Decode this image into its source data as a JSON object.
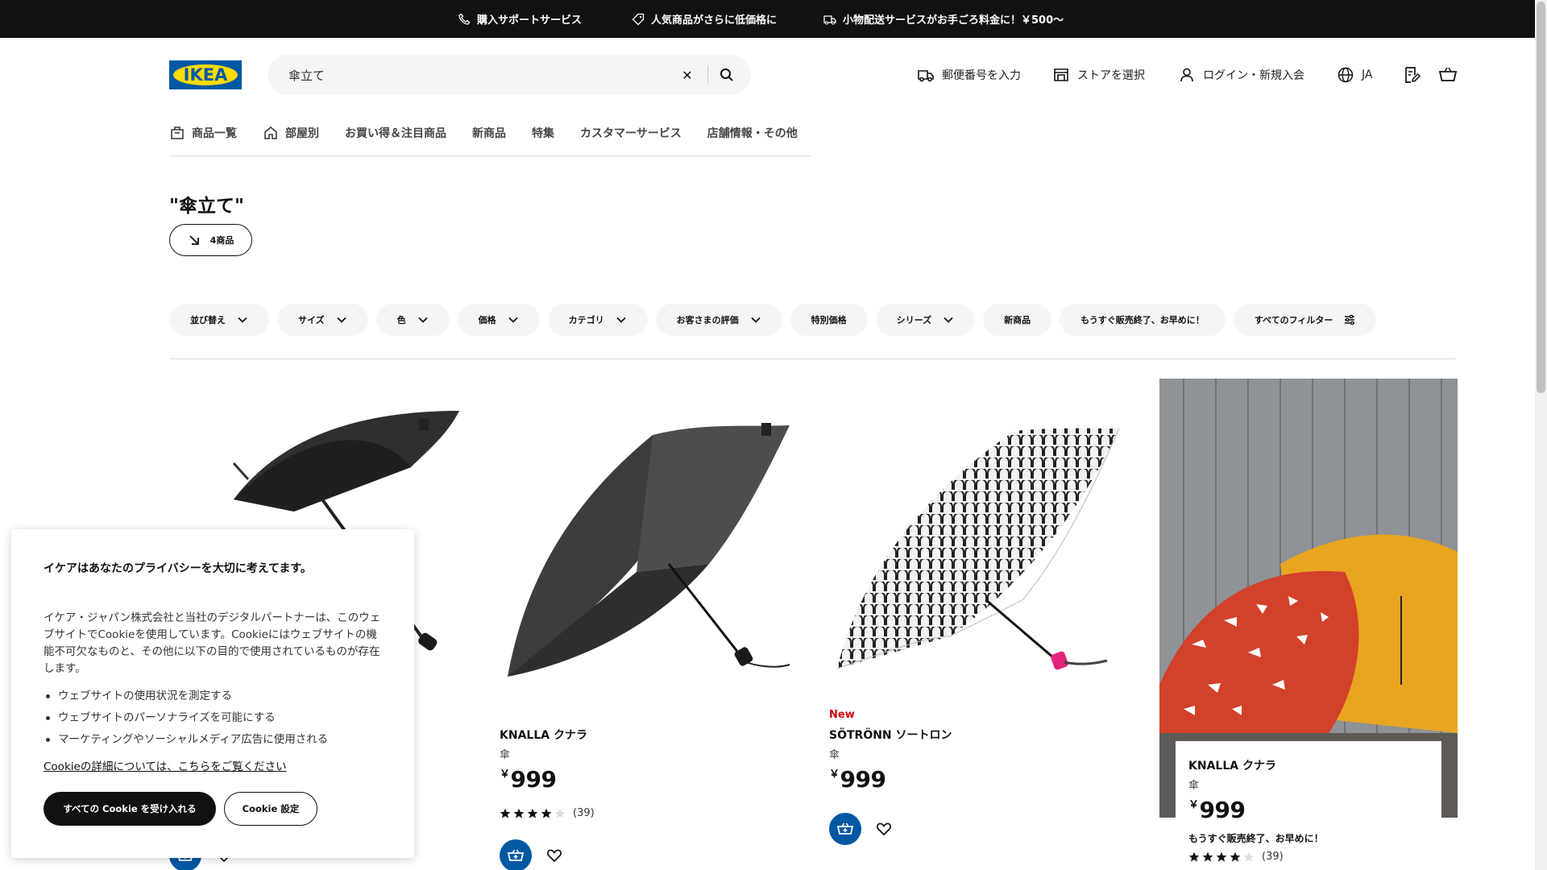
{
  "promo_bar": {
    "items": [
      {
        "label": "購入サポートサービス",
        "icon": "phone-icon"
      },
      {
        "label": "人気商品がさらに低価格に",
        "icon": "price-tag-icon"
      },
      {
        "label": "小物配送サービスがお手ごろ料金に！￥500〜",
        "icon": "truck-icon"
      }
    ]
  },
  "header": {
    "logo_text": "IKEA",
    "search": {
      "value": "傘立て"
    },
    "postcode_label": "郵便番号を入力",
    "store_label": "ストアを選択",
    "login_label": "ログイン・新規入会",
    "language_label": "JA"
  },
  "nav": {
    "items": [
      {
        "label": "商品一覧",
        "icon": "products-icon"
      },
      {
        "label": "部屋別",
        "icon": "home-icon"
      },
      {
        "label": "お買い得＆注目商品"
      },
      {
        "label": "新商品"
      },
      {
        "label": "特集"
      },
      {
        "label": "カスタマーサービス"
      },
      {
        "label": "店舗情報・その他"
      }
    ]
  },
  "results": {
    "title": "\"傘立て\"",
    "count_label": "4商品"
  },
  "filters": [
    {
      "label": "並び替え",
      "icon": "chevron-down-icon"
    },
    {
      "label": "サイズ",
      "icon": "chevron-down-icon"
    },
    {
      "label": "色",
      "icon": "chevron-down-icon"
    },
    {
      "label": "価格",
      "icon": "chevron-down-icon"
    },
    {
      "label": "カテゴリ",
      "icon": "chevron-down-icon"
    },
    {
      "label": "お客さまの評価",
      "icon": "chevron-down-icon"
    },
    {
      "label": "特別価格"
    },
    {
      "label": "シリーズ",
      "icon": "chevron-down-icon"
    },
    {
      "label": "新商品"
    },
    {
      "label": "もうすぐ販売終了、お早めに！"
    },
    {
      "label": "すべてのフィルター",
      "icon": "sliders-icon"
    }
  ],
  "products": [
    {
      "name": "",
      "type": "",
      "price_currency": "",
      "price": "",
      "rating": null,
      "reviews": ""
    },
    {
      "name": "KNALLA クナラ",
      "type": "傘",
      "price_currency": "￥",
      "price": "999",
      "rating": 4,
      "reviews": "(39)"
    },
    {
      "badge": "New",
      "name": "SÖTRÖNN ソートロン",
      "type": "傘",
      "price_currency": "￥",
      "price": "999"
    },
    {
      "name": "KNALLA クナラ",
      "type": "傘",
      "price_currency": "￥",
      "price": "999",
      "note": "もうすぐ販売終了、お早めに！",
      "rating": 4,
      "reviews": "(39)"
    }
  ],
  "cookie": {
    "title": "イケアはあなたのプライバシーを大切に考えてます。",
    "body": "イケア・ジャパン株式会社と当社のデジタルパートナーは、このウェブサイトでCookieを使用しています。Cookieにはウェブサイトの機能不可欠なものと、その他に以下の目的で使用されているものが存在します。",
    "purposes": [
      "ウェブサイトの使用状況を測定する",
      "ウェブサイトのパーソナライズを可能にする",
      "マーケティングやソーシャルメディア広告に使用される"
    ],
    "link": "Cookieの詳細については、こちらをご覧ください",
    "accept_label": "すべての Cookie を受け入れる",
    "settings_label": "Cookie 設定"
  },
  "colors": {
    "brand_blue": "#0058a3",
    "brand_yellow": "#ffdb00",
    "new_badge": "#cc0008"
  }
}
